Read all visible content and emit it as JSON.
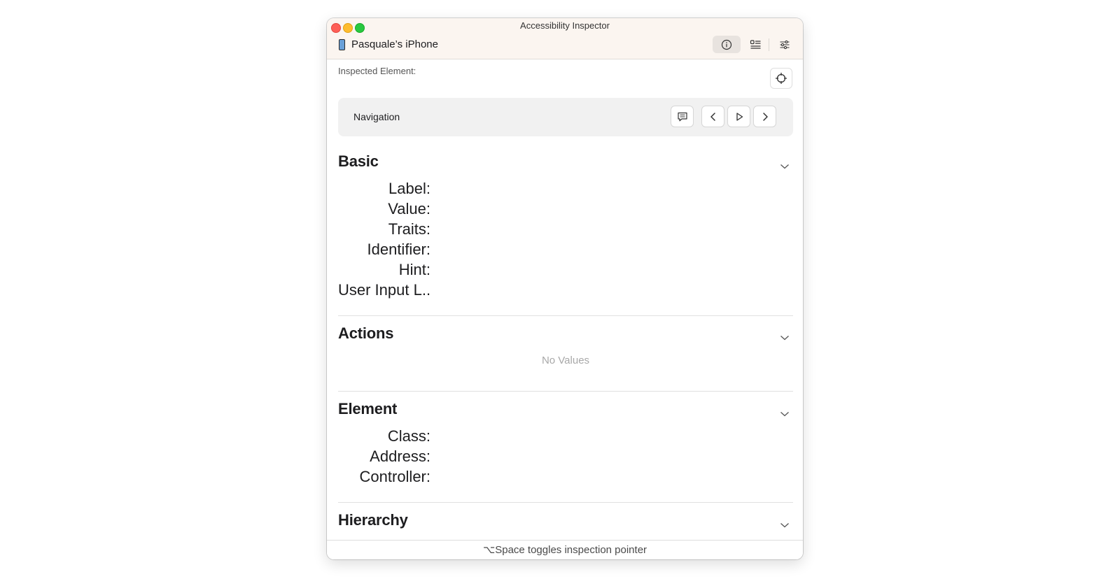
{
  "window": {
    "title": "Accessibility Inspector"
  },
  "toolbar": {
    "device_name": "Pasquale’s iPhone",
    "device_icon": "iphone-icon",
    "buttons": [
      "info-icon",
      "list-icon",
      "settings-sliders-icon"
    ]
  },
  "inspector": {
    "inspected_label": "Inspected Element:",
    "target_icon": "crosshair-icon"
  },
  "navigation": {
    "title": "Navigation",
    "buttons": [
      "speech-bubble-icon",
      "chevron-left-icon",
      "play-icon",
      "chevron-right-icon"
    ]
  },
  "sections": {
    "basic": {
      "title": "Basic",
      "fields": [
        "Label:",
        "Value:",
        "Traits:",
        "Identifier:",
        "Hint:",
        "User Input L..."
      ]
    },
    "actions": {
      "title": "Actions",
      "empty_text": "No Values"
    },
    "element": {
      "title": "Element",
      "fields": [
        "Class:",
        "Address:",
        "Controller:"
      ]
    },
    "hierarchy": {
      "title": "Hierarchy"
    }
  },
  "footer": {
    "text": "⌥Space toggles inspection pointer"
  },
  "colors": {
    "close": "#fe5f57",
    "minimize": "#febc2e",
    "maximize": "#28c840",
    "titlebar": "#fbf5f0",
    "nav_panel": "#f1f1f1"
  }
}
